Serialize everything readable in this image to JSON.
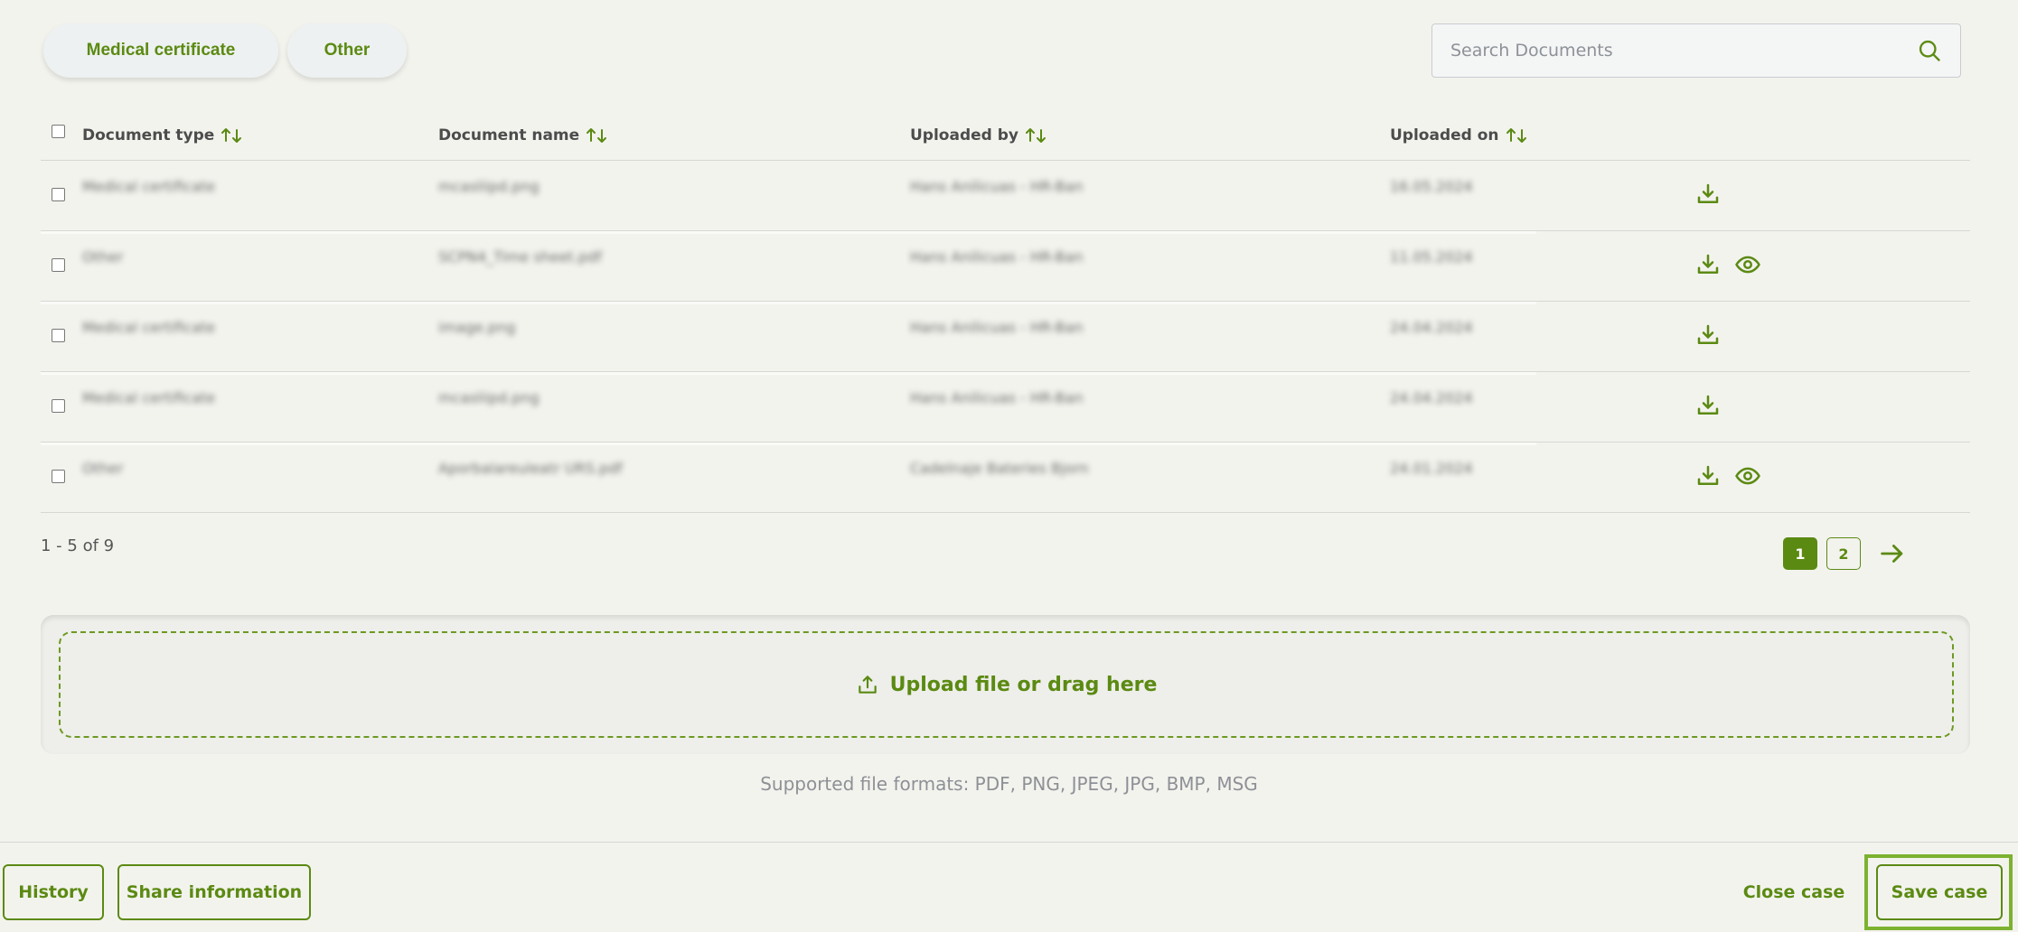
{
  "filters": [
    {
      "label": "Medical certificate"
    },
    {
      "label": "Other"
    }
  ],
  "search": {
    "placeholder": "Search Documents"
  },
  "table": {
    "headers": {
      "type": "Document type",
      "name": "Document name",
      "by": "Uploaded by",
      "on": "Uploaded on"
    },
    "rows": [
      {
        "type": "Medical certificate",
        "name": "mcasliipd.png",
        "by": "Hans Anilicuas - HR-Ban",
        "on": "16.05.2024",
        "preview": false
      },
      {
        "type": "Other",
        "name": "SCPN4_Time sheet.pdf",
        "by": "Hans Anilicuas - HR-Ban",
        "on": "11.05.2024",
        "preview": true
      },
      {
        "type": "Medical certificate",
        "name": "image.png",
        "by": "Hans Anilicuas - HR-Ban",
        "on": "24.04.2024",
        "preview": false
      },
      {
        "type": "Medical certificate",
        "name": "mcasliipd.png",
        "by": "Hans Anilicuas - HR-Ban",
        "on": "24.04.2024",
        "preview": false
      },
      {
        "type": "Other",
        "name": "Aporbalareuleatr URS.pdf",
        "by": "Cadelnaje Bateries Bjorn",
        "on": "24.01.2024",
        "preview": true
      }
    ]
  },
  "pagination": {
    "summary": "1 - 5 of 9",
    "pages": [
      "1",
      "2"
    ],
    "current": "1"
  },
  "upload": {
    "label": "Upload file or drag here",
    "formats": "Supported file formats: PDF, PNG, JPEG, JPG, BMP, MSG"
  },
  "footer": {
    "history": "History",
    "share": "Share information",
    "close": "Close case",
    "save": "Save case"
  },
  "colors": {
    "accent": "#5b8a12",
    "highlight": "#7cb230"
  }
}
